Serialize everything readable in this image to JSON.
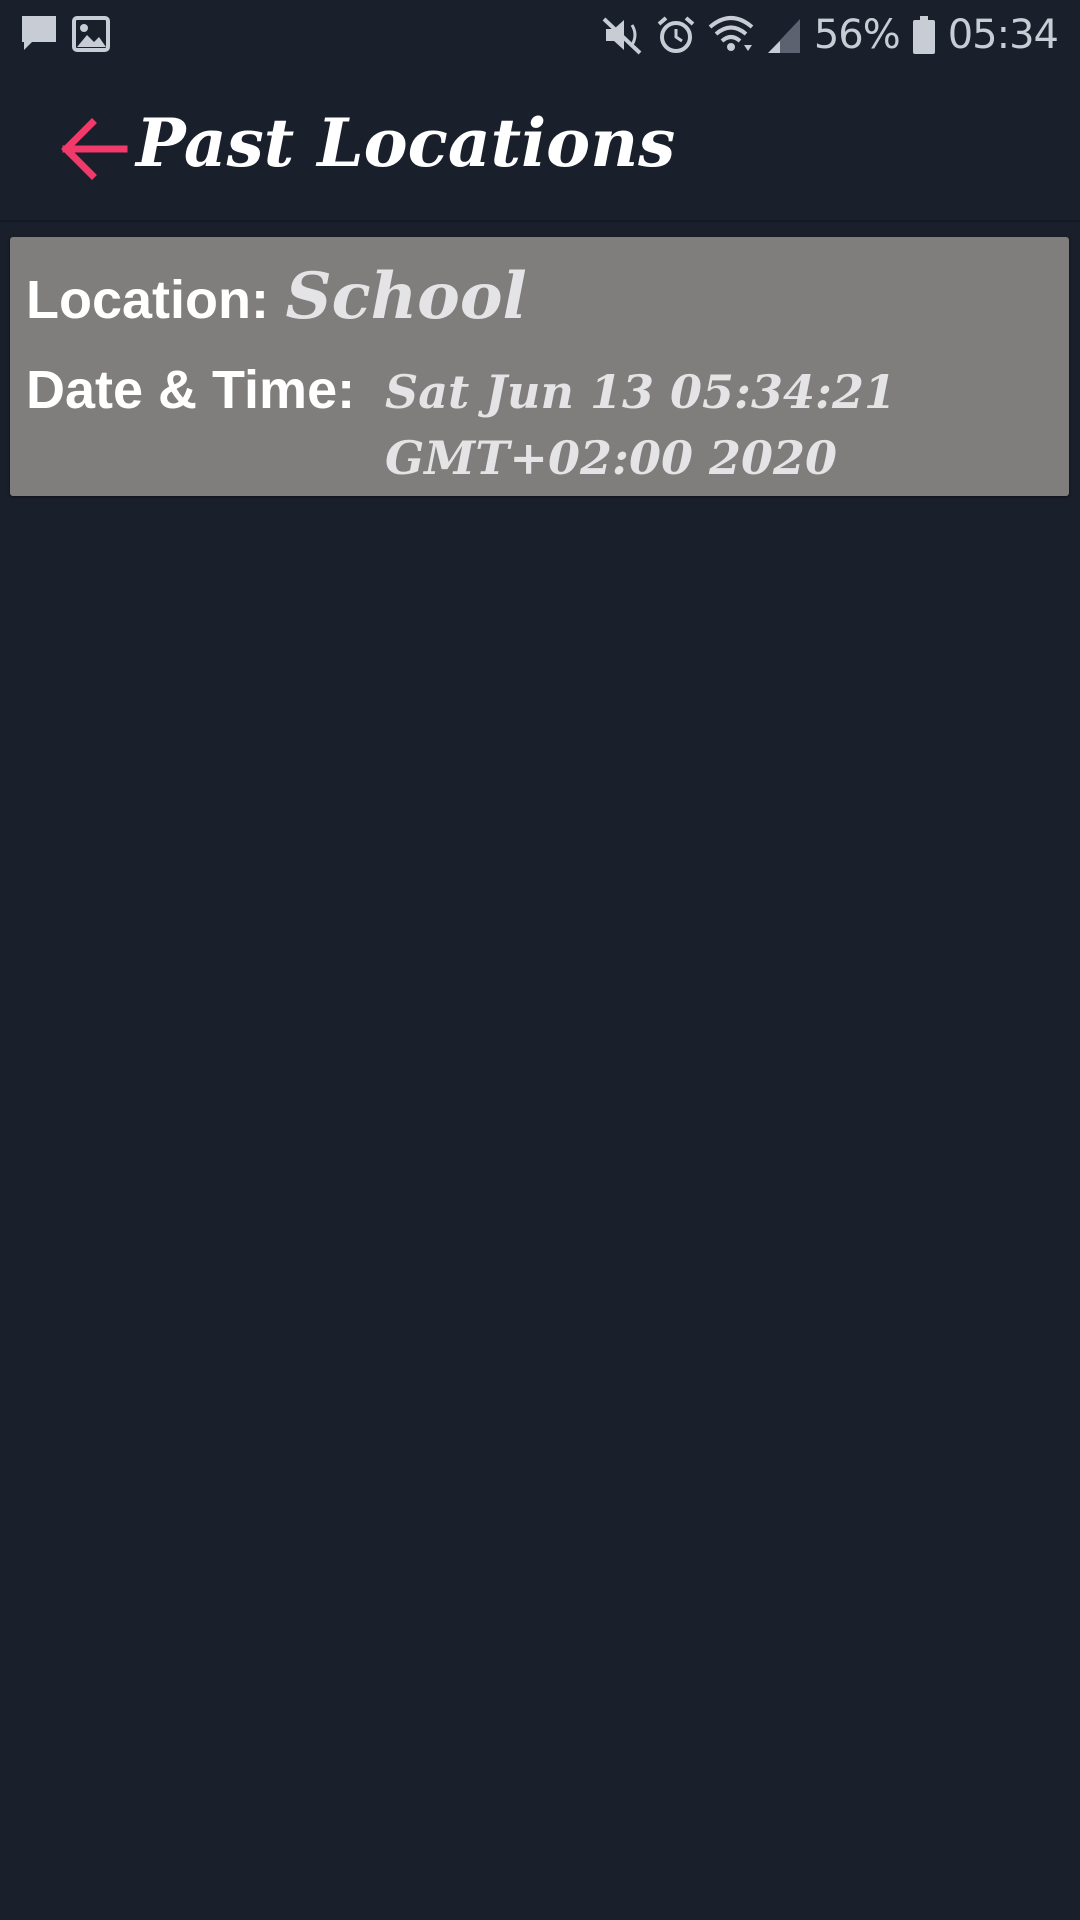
{
  "status_bar": {
    "battery": "56%",
    "time": "05:34",
    "icons": [
      "message-icon",
      "gallery-icon",
      "mute-icon",
      "alarm-icon",
      "wifi-icon",
      "signal-icon",
      "battery-icon"
    ]
  },
  "app_bar": {
    "title": "Past Locations",
    "back_icon": "arrow-left-icon",
    "accent_color": "#f23a6a"
  },
  "locations": [
    {
      "location_label": "Location:",
      "location_value": "School",
      "datetime_label": "Date & Time:",
      "datetime_value": "Sat Jun 13 05:34:21 GMT+02:00 2020"
    }
  ],
  "colors": {
    "background": "#1a1f2c",
    "card": "#7f7e7c"
  }
}
